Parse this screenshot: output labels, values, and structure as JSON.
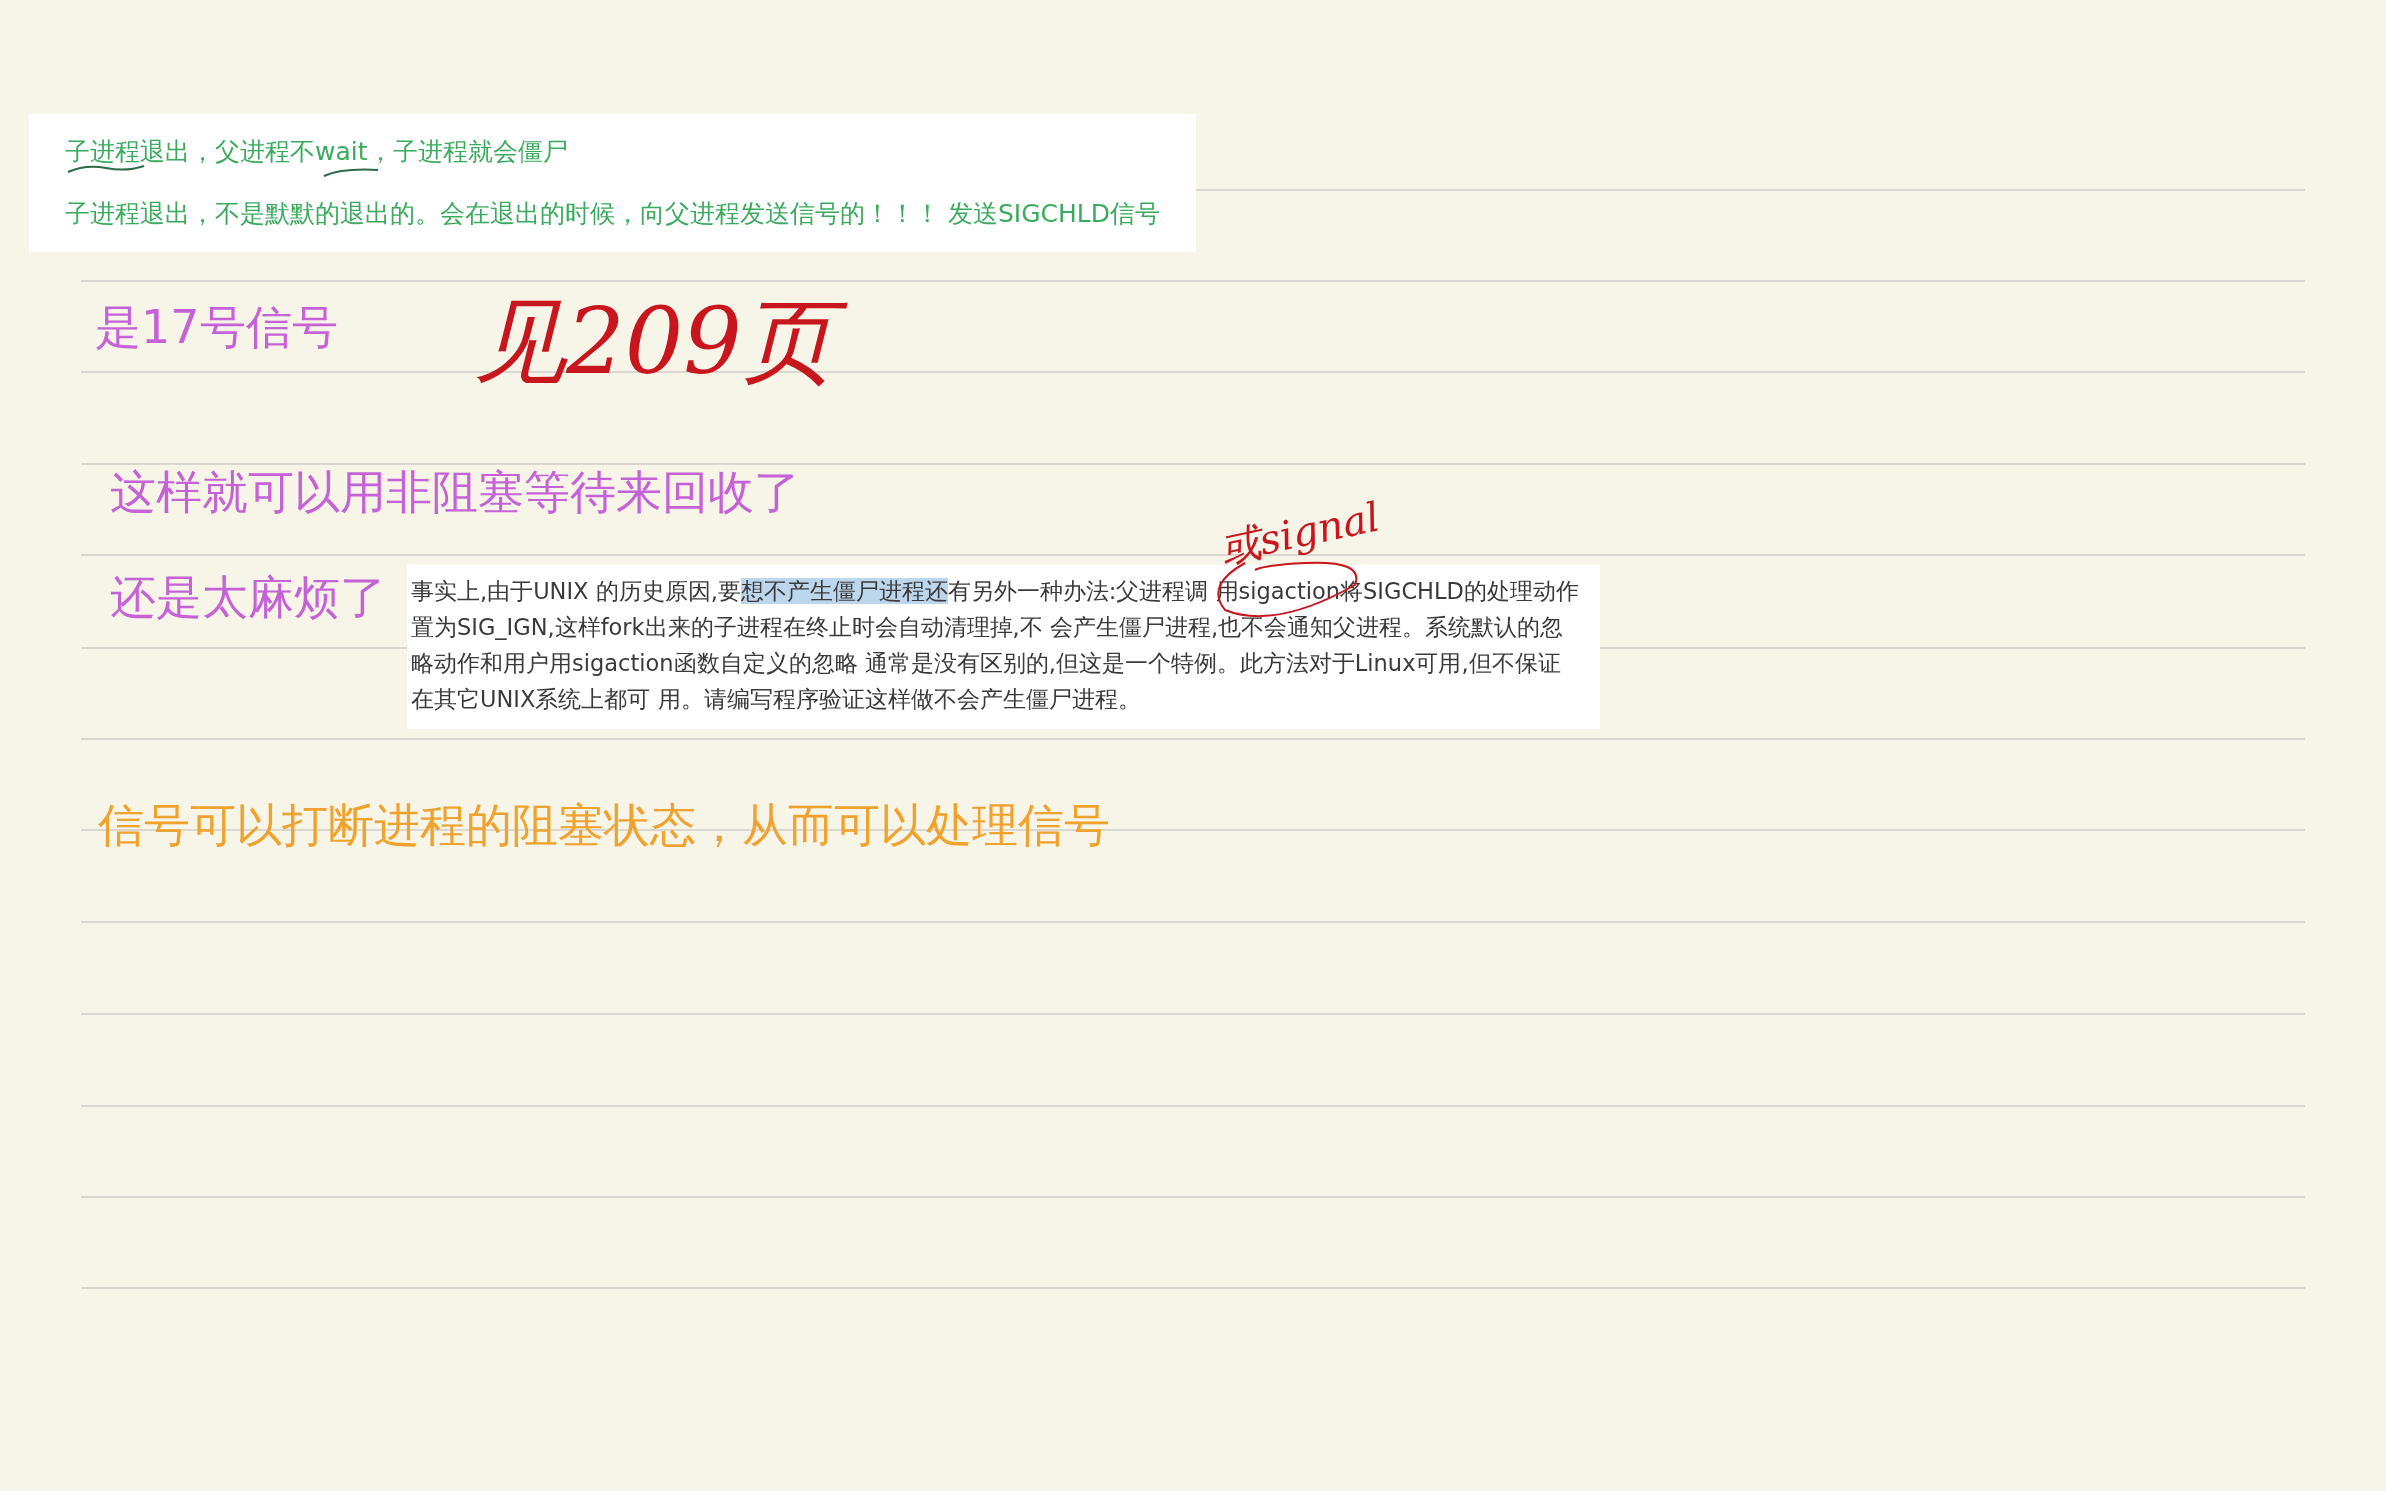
{
  "page": {
    "items": [
      {
        "kind": "clipping",
        "lines": [
          "子进程退出，父进程不wait，子进程就会僵尸",
          "子进程退出，不是默默的退出的。会在退出的时候，向父进程发送信号的！！！ 发送SIGCHLD信号"
        ]
      },
      {
        "kind": "note",
        "text": "是17号信号",
        "color": "#c563d6"
      },
      {
        "kind": "handwriting",
        "text": "见209页",
        "color": "#c8161e"
      },
      {
        "kind": "note",
        "text": "这样就可以用非阻塞等待来回收了",
        "color": "#c563d6"
      },
      {
        "kind": "handwriting",
        "text": "或signal",
        "color": "#c8161e"
      },
      {
        "kind": "note",
        "text": "还是太麻烦了",
        "color": "#c563d6"
      },
      {
        "kind": "excerpt",
        "segments": [
          {
            "text": "事实上,由于UNIX 的历史原因,要",
            "highlighted": false
          },
          {
            "text": "想不产生僵尸进程还",
            "highlighted": true
          },
          {
            "text": "有另外一种办法:父进程调 用sigaction将SIGCHLD的处理动作置为SIG_IGN,这样fork出来的子进程在终止时会自动清理掉,不 会产生僵尸进程,也不会通知父进程。系统默认的忽略动作和用户用sigaction函数自定义的忽略 通常是没有区别的,但这是一个特例。此方法对于Linux可用,但不保证在其它UNIX系统上都可 用。请编写程序验证这样做不会产生僵尸进程。",
            "highlighted": false
          }
        ]
      },
      {
        "kind": "note",
        "text": "信号可以打断进程的阻塞状态，从而可以处理信号",
        "color": "#f0a22e"
      }
    ]
  }
}
